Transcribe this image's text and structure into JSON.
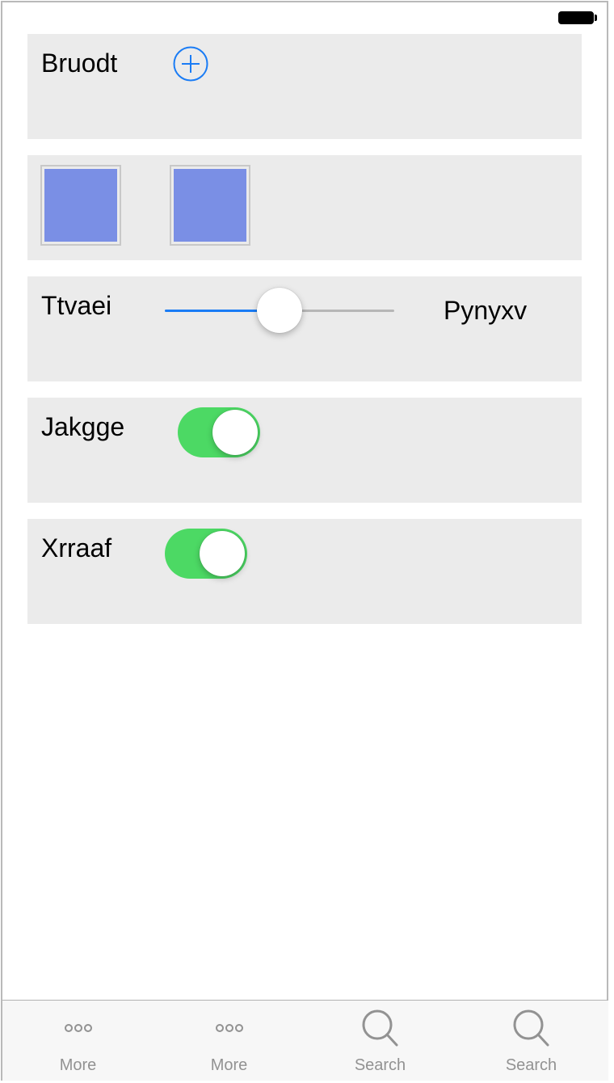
{
  "status_bar": {
    "battery_icon": "battery-full-icon"
  },
  "rows": {
    "add_row": {
      "label": "Bruodt",
      "icon": "plus-circle-icon",
      "accent": "#1a7cf5"
    },
    "color_squares": {
      "items": [
        {
          "color": "#7a8fe5"
        },
        {
          "color": "#7a8fe5"
        }
      ]
    },
    "slider_row": {
      "label": "Ttvaei",
      "max_label": "Pynyxv",
      "value": 0.5,
      "fill_color": "#1a7cf5"
    },
    "toggle_row_1": {
      "label": "Jakgge",
      "on": true,
      "on_color": "#4cd964"
    },
    "toggle_row_2": {
      "label": "Xrraaf",
      "on": true,
      "on_color": "#4cd964"
    }
  },
  "tab_bar": {
    "tabs": [
      {
        "label": "More",
        "icon": "more-dots-icon"
      },
      {
        "label": "More",
        "icon": "more-dots-icon"
      },
      {
        "label": "Search",
        "icon": "search-icon"
      },
      {
        "label": "Search",
        "icon": "search-icon"
      }
    ]
  }
}
